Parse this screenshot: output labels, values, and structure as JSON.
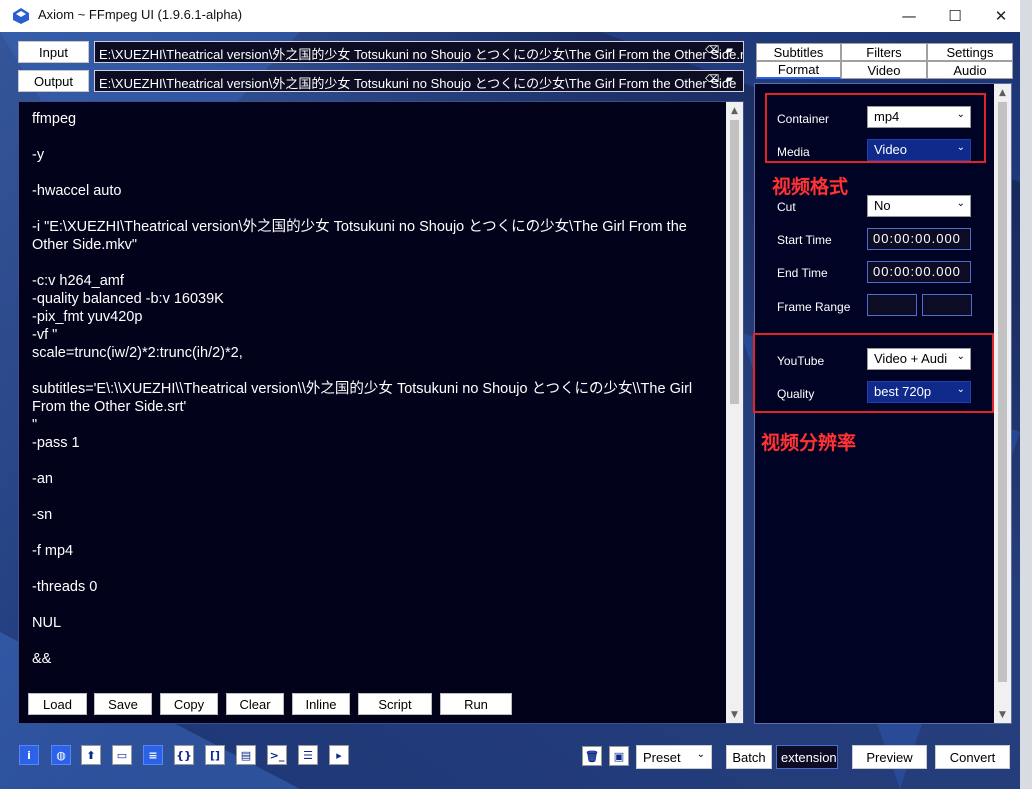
{
  "window": {
    "title": "Axiom ~ FFmpeg UI (1.9.6.1-alpha)",
    "controls": {
      "minimize": "—",
      "maximize": "☐",
      "close": "✕"
    }
  },
  "io": {
    "input_label": "Input",
    "input_value": "E:\\XUEZHI\\Theatrical version\\外之国的少女 Totsukuni no Shoujo とつくにの少女\\The Girl From the Other Side.mkv",
    "output_label": "Output",
    "output_value": "E:\\XUEZHI\\Theatrical version\\外之国的少女 Totsukuni no Shoujo とつくにの少女\\The Girl From the Other Side"
  },
  "script_text": "ffmpeg\n\n-y\n\n-hwaccel auto\n\n-i \"E:\\XUEZHI\\Theatrical version\\外之国的少女 Totsukuni no Shoujo とつくにの少女\\The Girl From the Other Side.mkv\"\n\n-c:v h264_amf\n-quality balanced -b:v 16039K\n-pix_fmt yuv420p\n-vf \"\nscale=trunc(iw/2)*2:trunc(ih/2)*2,\n\nsubtitles='E\\:\\\\XUEZHI\\\\Theatrical version\\\\外之国的少女 Totsukuni no Shoujo とつくにの少女\\\\The Girl From the Other Side.srt'\n\"\n-pass 1\n\n-an\n\n-sn\n\n-f mp4\n\n-threads 0\n\nNUL\n\n&&",
  "actions": [
    "Load",
    "Save",
    "Copy",
    "Clear",
    "Inline",
    "Script",
    "Run"
  ],
  "tabs": {
    "row1": [
      "Subtitles",
      "Filters",
      "Settings"
    ],
    "row2": [
      "Format",
      "Video",
      "Audio"
    ],
    "active": "Format"
  },
  "format": {
    "container_label": "Container",
    "container_value": "mp4",
    "media_label": "Media",
    "media_value": "Video",
    "cut_label": "Cut",
    "cut_value": "No",
    "start_time_label": "Start Time",
    "start_time_value": "00:00:00.000",
    "end_time_label": "End Time",
    "end_time_value": "00:00:00.000",
    "frame_range_label": "Frame Range",
    "youtube_label": "YouTube",
    "youtube_value": "Video + Audi",
    "quality_label": "Quality",
    "quality_value": "best 720p"
  },
  "annotations": {
    "video_format": "视频格式",
    "video_resolution": "视频分辨率"
  },
  "bottom_icons": [
    "info-icon",
    "globe-icon",
    "upload-icon",
    "window-icon",
    "list-icon",
    "braces-icon",
    "brackets-icon",
    "document-icon",
    "terminal-icon",
    "bullet-list-icon",
    "play-icon"
  ],
  "bottom_glyphs": [
    "i",
    "◍",
    "⬆",
    "▭",
    "≡",
    "{}",
    "[]",
    "▤",
    ">_",
    "☰",
    "▸"
  ],
  "bottom": {
    "preset_label": "Preset",
    "batch_label": "Batch",
    "extension_label": "extension",
    "preview_label": "Preview",
    "convert_label": "Convert"
  },
  "colors": {
    "accent": "#2b62e8",
    "annotation": "#e0242a",
    "panel_bg": "#010325"
  }
}
